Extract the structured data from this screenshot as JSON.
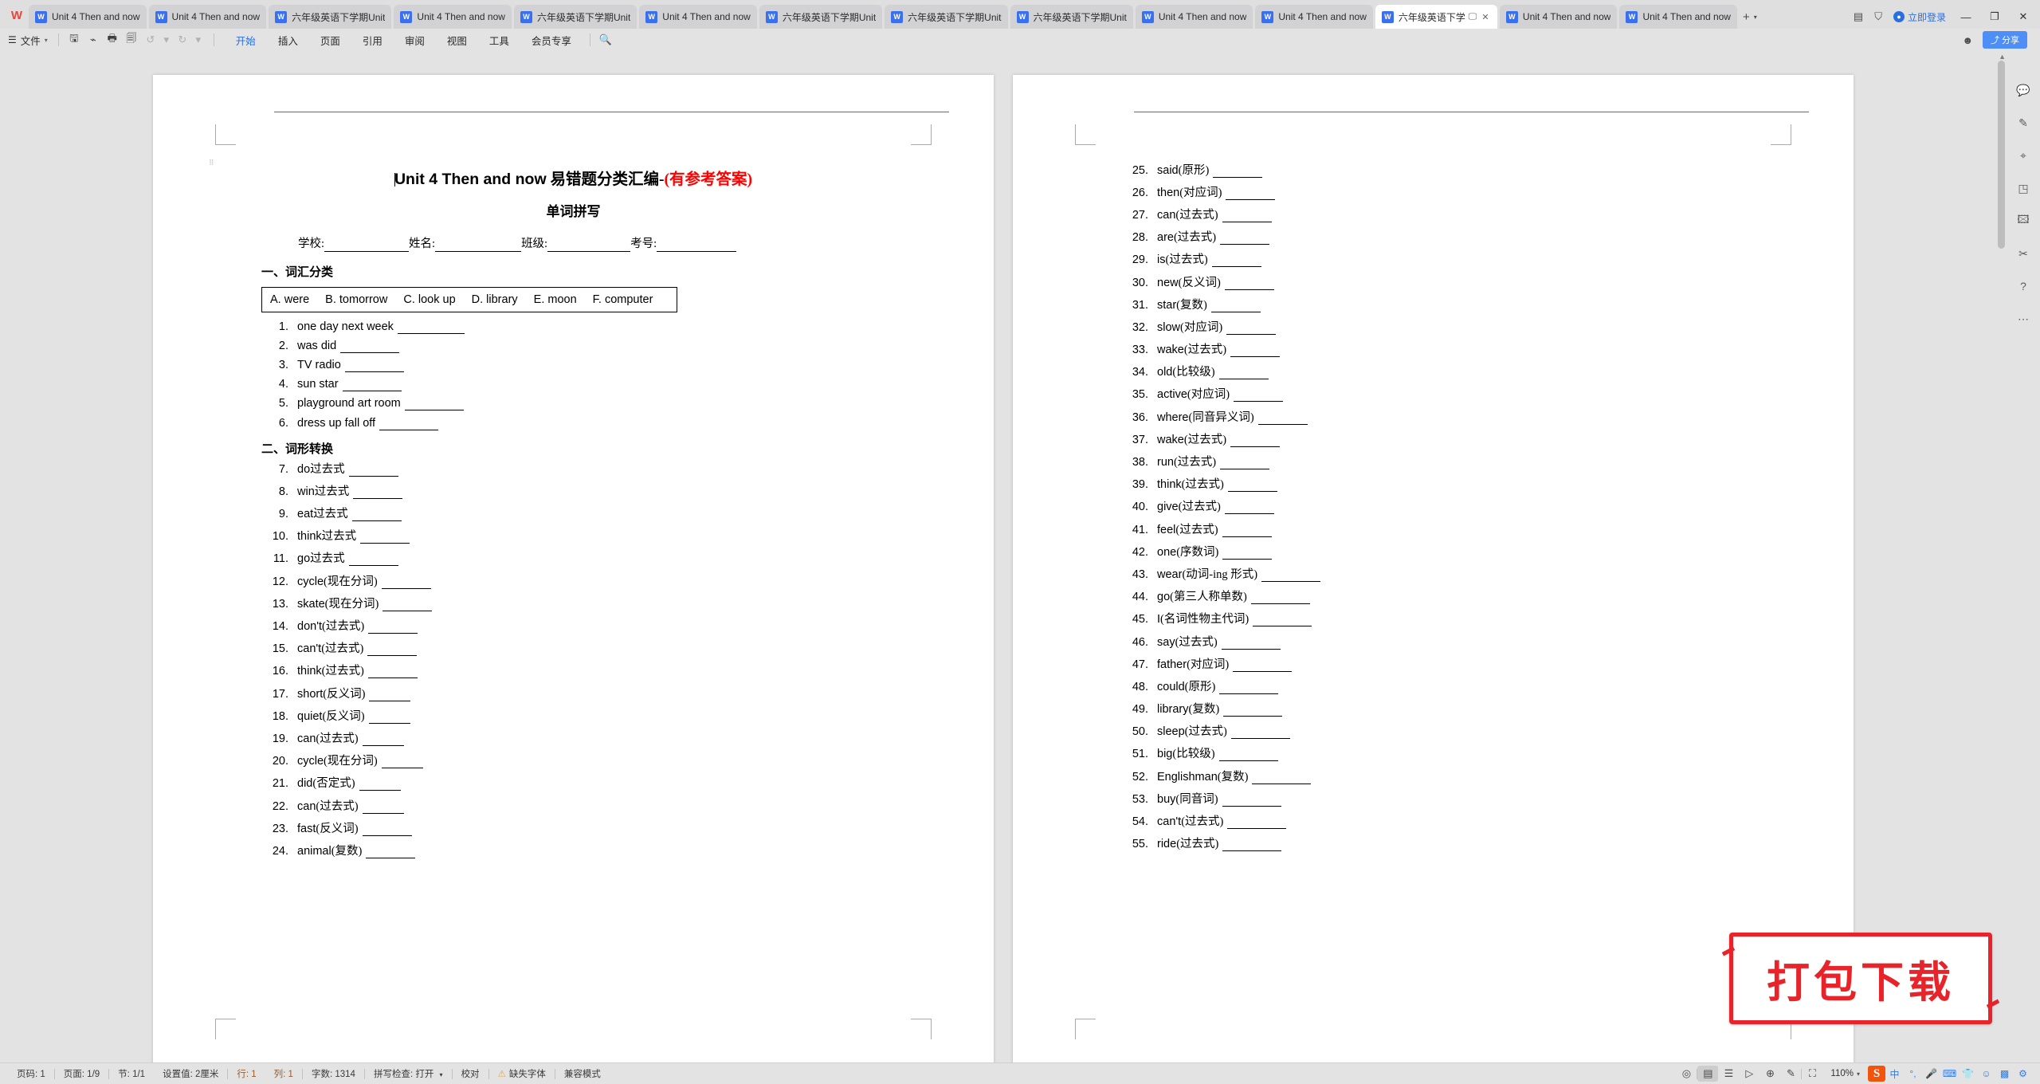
{
  "app": {
    "logo": "W",
    "login_label": "立即登录"
  },
  "tabs": [
    {
      "label": "Unit 4 Then and now",
      "active": false
    },
    {
      "label": "Unit 4 Then and now",
      "active": false
    },
    {
      "label": "六年级英语下学期Unit",
      "active": false
    },
    {
      "label": "Unit 4 Then and now",
      "active": false
    },
    {
      "label": "六年级英语下学期Unit",
      "active": false
    },
    {
      "label": "Unit 4 Then and now",
      "active": false
    },
    {
      "label": "六年级英语下学期Unit",
      "active": false
    },
    {
      "label": "六年级英语下学期Unit",
      "active": false
    },
    {
      "label": "六年级英语下学期Unit",
      "active": false
    },
    {
      "label": "Unit 4 Then and now",
      "active": false
    },
    {
      "label": "Unit 4 Then and now",
      "active": false
    },
    {
      "label": "六年级英语下学",
      "active": true
    },
    {
      "label": "Unit 4 Then and now",
      "active": false
    },
    {
      "label": "Unit 4 Then and now",
      "active": false
    }
  ],
  "ribbon": {
    "file_label": "文件",
    "quick_icons": [
      "save-icon",
      "cloud-save-icon",
      "print-icon",
      "print-preview-icon",
      "undo-icon",
      "redo-icon",
      "customize-icon"
    ],
    "menu": [
      {
        "label": "开始",
        "active": true
      },
      {
        "label": "插入",
        "active": false
      },
      {
        "label": "页面",
        "active": false
      },
      {
        "label": "引用",
        "active": false
      },
      {
        "label": "审阅",
        "active": false
      },
      {
        "label": "视图",
        "active": false
      },
      {
        "label": "工具",
        "active": false
      },
      {
        "label": "会员专享",
        "active": false
      }
    ],
    "search_icon": "search-icon",
    "share_label": "分享"
  },
  "document": {
    "title_en": "Unit 4 Then and now",
    "title_cn": " 易错题分类汇编-",
    "title_red": "(有参考答案)",
    "subtitle": "单词拼写",
    "meta": [
      {
        "label": "学校:",
        "blank": 106
      },
      {
        "label": "姓名:",
        "blank": 108
      },
      {
        "label": "班级:",
        "blank": 104
      },
      {
        "label": "考号:",
        "blank": 100
      }
    ],
    "section1_head": "一、词汇分类",
    "word_bank": [
      "A.  were",
      "B.  tomorrow",
      "C.   look up",
      "D.  library",
      "E.  moon",
      "F. computer"
    ],
    "section2_head": "二、词形转换",
    "left_items": [
      {
        "num": "1.",
        "text": "one day    next week ",
        "cn": "",
        "blank": "b-xl"
      },
      {
        "num": "2.",
        "text": "was    did ",
        "cn": "",
        "blank": "b-lg"
      },
      {
        "num": "3.",
        "text": "TV    radio ",
        "cn": "",
        "blank": "b-lg"
      },
      {
        "num": "4.",
        "text": "sun    star ",
        "cn": "",
        "blank": "b-lg"
      },
      {
        "num": "5.",
        "text": "playground    art room ",
        "cn": "",
        "blank": "b-lg"
      },
      {
        "num": "6.",
        "text": "dress up    fall off ",
        "cn": "",
        "blank": "b-lg"
      },
      {
        "num": "7.",
        "text": "do ",
        "cn": "过去式",
        "blank": "b-md"
      },
      {
        "num": "8.",
        "text": "win ",
        "cn": "过去式",
        "blank": "b-md"
      },
      {
        "num": "9.",
        "text": "eat ",
        "cn": "过去式",
        "blank": "b-md"
      },
      {
        "num": "10.",
        "text": "think ",
        "cn": "过去式",
        "blank": "b-md"
      },
      {
        "num": "11.",
        "text": "go ",
        "cn": "过去式",
        "blank": "b-md"
      },
      {
        "num": "12.",
        "text": "cycle ",
        "cn": "(现在分词)",
        "blank": "b-md"
      },
      {
        "num": "13.",
        "text": "skate ",
        "cn": "(现在分词)",
        "blank": "b-md"
      },
      {
        "num": "14.",
        "text": "don't ",
        "cn": "(过去式)",
        "blank": "b-md"
      },
      {
        "num": "15.",
        "text": "can't ",
        "cn": "(过去式)",
        "blank": "b-md"
      },
      {
        "num": "16.",
        "text": "think ",
        "cn": "(过去式)",
        "blank": "b-md"
      },
      {
        "num": "17.",
        "text": "short ",
        "cn": "(反义词)",
        "blank": "b-sm"
      },
      {
        "num": "18.",
        "text": "quiet ",
        "cn": "(反义词)",
        "blank": "b-sm"
      },
      {
        "num": "19.",
        "text": "can ",
        "cn": "(过去式)",
        "blank": "b-sm"
      },
      {
        "num": "20.",
        "text": "cycle ",
        "cn": "(现在分词)",
        "blank": "b-sm"
      },
      {
        "num": "21.",
        "text": "did ",
        "cn": "(否定式)",
        "blank": "b-sm"
      },
      {
        "num": "22.",
        "text": "can ",
        "cn": "(过去式)",
        "blank": "b-sm"
      },
      {
        "num": "23.",
        "text": "fast ",
        "cn": "(反义词)",
        "blank": "b-md"
      },
      {
        "num": "24.",
        "text": "animal ",
        "cn": "(复数)",
        "blank": "b-md"
      }
    ],
    "right_items": [
      {
        "num": "25.",
        "text": "said ",
        "cn": "(原形)",
        "blank": "b-md"
      },
      {
        "num": "26.",
        "text": "then ",
        "cn": "(对应词)",
        "blank": "b-md"
      },
      {
        "num": "27.",
        "text": "can ",
        "cn": "(过去式)",
        "blank": "b-md"
      },
      {
        "num": "28.",
        "text": "are ",
        "cn": "(过去式)",
        "blank": "b-md"
      },
      {
        "num": "29.",
        "text": "is ",
        "cn": "(过去式)",
        "blank": "b-md"
      },
      {
        "num": "30.",
        "text": "new ",
        "cn": "(反义词)",
        "blank": "b-md"
      },
      {
        "num": "31.",
        "text": "star ",
        "cn": "(复数)",
        "blank": "b-md"
      },
      {
        "num": "32.",
        "text": "slow ",
        "cn": "(对应词)",
        "blank": "b-md"
      },
      {
        "num": "33.",
        "text": "wake ",
        "cn": "(过去式)",
        "blank": "b-md"
      },
      {
        "num": "34.",
        "text": "old ",
        "cn": "(比较级)",
        "blank": "b-md"
      },
      {
        "num": "35.",
        "text": "active ",
        "cn": "(对应词)",
        "blank": "b-md"
      },
      {
        "num": "36.",
        "text": "where ",
        "cn": "(同音异义词)",
        "blank": "b-md"
      },
      {
        "num": "37.",
        "text": "wake ",
        "cn": "(过去式)",
        "blank": "b-md"
      },
      {
        "num": "38.",
        "text": "run ",
        "cn": "(过去式)",
        "blank": "b-md"
      },
      {
        "num": "39.",
        "text": "think ",
        "cn": "(过去式)",
        "blank": "b-md"
      },
      {
        "num": "40.",
        "text": "give ",
        "cn": "(过去式)",
        "blank": "b-md"
      },
      {
        "num": "41.",
        "text": "feel ",
        "cn": "(过去式)",
        "blank": "b-md"
      },
      {
        "num": "42.",
        "text": "one ",
        "cn": "(序数词)",
        "blank": "b-md"
      },
      {
        "num": "43.",
        "text": "wear ",
        "cn": "(动词-ing 形式)",
        "blank": "b-lg"
      },
      {
        "num": "44.",
        "text": "go ",
        "cn": "(第三人称单数)",
        "blank": "b-lg"
      },
      {
        "num": "45.",
        "text": "I ",
        "cn": "(名词性物主代词)",
        "blank": "b-lg"
      },
      {
        "num": "46.",
        "text": "say ",
        "cn": "(过去式)",
        "blank": "b-lg"
      },
      {
        "num": "47.",
        "text": "father ",
        "cn": "(对应词)",
        "blank": "b-lg"
      },
      {
        "num": "48.",
        "text": "could ",
        "cn": "(原形)",
        "blank": "b-lg"
      },
      {
        "num": "49.",
        "text": "library ",
        "cn": "(复数)",
        "blank": "b-lg"
      },
      {
        "num": "50.",
        "text": "sleep ",
        "cn": "(过去式)",
        "blank": "b-lg"
      },
      {
        "num": "51.",
        "text": "big ",
        "cn": "(比较级)",
        "blank": "b-lg"
      },
      {
        "num": "52.",
        "text": "Englishman ",
        "cn": "(复数)",
        "blank": "b-lg"
      },
      {
        "num": "53.",
        "text": "buy ",
        "cn": "(同音词)",
        "blank": "b-lg"
      },
      {
        "num": "54.",
        "text": "can't ",
        "cn": "(过去式)",
        "blank": "b-lg"
      },
      {
        "num": "55.",
        "text": "ride ",
        "cn": "(过去式)",
        "blank": "b-lg"
      }
    ]
  },
  "stamp": {
    "label": "打包下载",
    "color": "#e8232a"
  },
  "statusbar": {
    "page_no": "页码: 1",
    "pages": "页面: 1/9",
    "section": "节: 1/1",
    "setting": "设置值: 2厘米",
    "row": "行: 1",
    "col": "列: 1",
    "words": "字数: 1314",
    "spellcheck": "拼写检查: 打开",
    "proof": "校对",
    "missing_font": "缺失字体",
    "compat": "兼容模式",
    "zoom": "110%",
    "ime_s": "S",
    "ime_lang": "中"
  }
}
